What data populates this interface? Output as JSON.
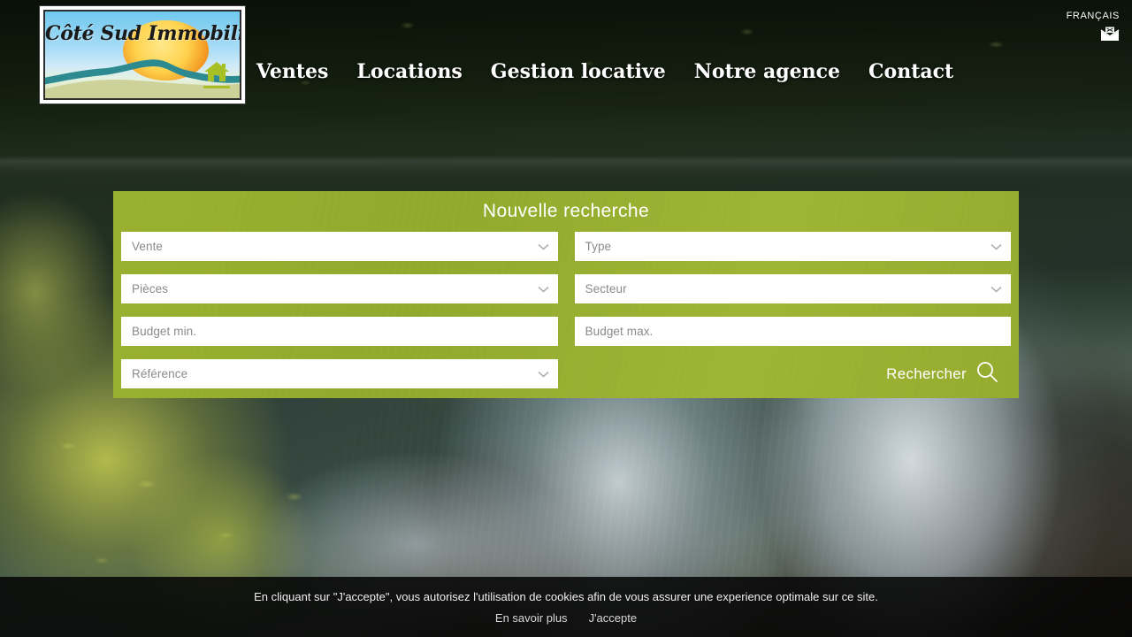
{
  "header": {
    "logo": {
      "text": "Côté Sud Immobilier",
      "alt_name": "cote-sud-immobilier-logo"
    },
    "language": {
      "label": "FRANÇAIS"
    },
    "mail_icon": "envelope-icon",
    "nav": [
      {
        "label": "",
        "icon": "home-icon",
        "active": true
      },
      {
        "label": "Ventes",
        "icon": "",
        "active": false
      },
      {
        "label": "Locations",
        "icon": "",
        "active": false
      },
      {
        "label": "Gestion locative",
        "icon": "",
        "active": false
      },
      {
        "label": "Notre agence",
        "icon": "",
        "active": false
      },
      {
        "label": "Contact",
        "icon": "",
        "active": false
      }
    ]
  },
  "search_panel": {
    "title": "Nouvelle recherche",
    "accent_color": "#93aa2d",
    "fields": [
      {
        "name": "transaction-type",
        "value": "Vente",
        "control": "select"
      },
      {
        "name": "property-type",
        "value": "Type",
        "control": "select"
      },
      {
        "name": "rooms",
        "value": "Pièces",
        "control": "select"
      },
      {
        "name": "sector",
        "value": "Secteur",
        "control": "select"
      },
      {
        "name": "budget-min",
        "value": "Budget min.",
        "control": "text"
      },
      {
        "name": "budget-max",
        "value": "Budget max.",
        "control": "text"
      },
      {
        "name": "reference",
        "value": "Référence",
        "control": "select"
      }
    ],
    "search_button": {
      "label": "Rechercher",
      "icon": "search-icon"
    }
  },
  "cookie_banner": {
    "message": "En cliquant sur \"J'accepte\", vous autorisez l'utilisation de cookies afin de vous assurer une experience optimale sur ce site.",
    "learn_more": "En savoir plus",
    "accept": "J'accepte"
  }
}
